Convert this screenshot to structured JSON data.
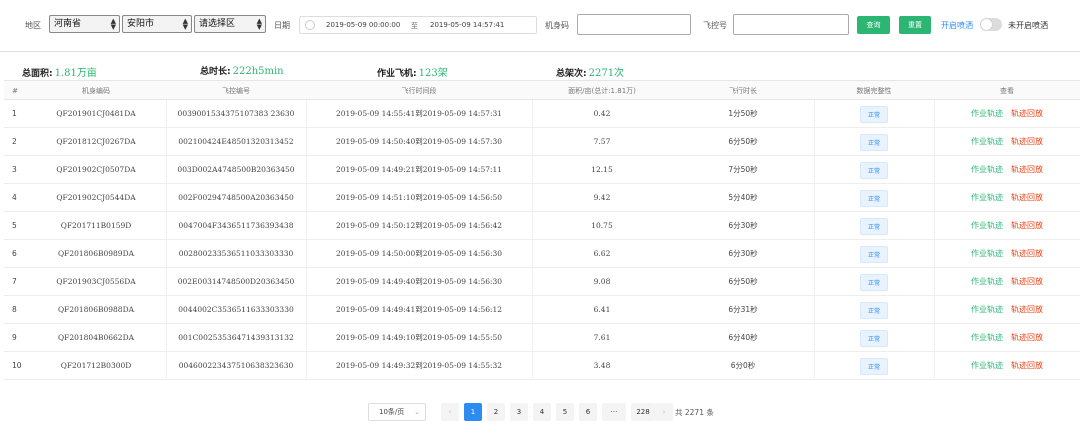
{
  "filters": {
    "region_label": "地区",
    "province": "河南省",
    "city": "安阳市",
    "district": "请选择区",
    "date_label": "日期",
    "date_start": "2019-05-09 00:00:00",
    "date_sep": "至",
    "date_end": "2019-05-09 14:57:41",
    "body_code_label": "机身码",
    "body_code_value": "",
    "fc_label": "飞控号",
    "fc_value": "",
    "query_button": "查询",
    "reset_button": "重置",
    "spray_on_link": "开启喷洒",
    "spray_off_label": "未开启喷洒"
  },
  "summary": {
    "area_label": "总面积:",
    "area_value": "1.81万亩",
    "duration_label": "总时长:",
    "duration_value": "222h5min",
    "aircraft_label": "作业飞机:",
    "aircraft_value": "123架",
    "sorties_label": "总架次:",
    "sorties_value": "2271次"
  },
  "table": {
    "headers": [
      "#",
      "机身编码",
      "飞控编号",
      "飞行时间段",
      "面积/亩(总计:1.81万)",
      "飞行时长",
      "数据完整性",
      "查看"
    ],
    "actions": {
      "work_track": "作业轨迹",
      "track_replay": "轨迹回放"
    },
    "rows": [
      {
        "idx": "1",
        "body": "QF201901CJ0481DA",
        "fc": "0039001534375107383 23630",
        "period": "2019-05-09 14:55:41到2019-05-09 14:57:31",
        "area": "0.42",
        "duration": "1分50秒",
        "status": "正常"
      },
      {
        "idx": "2",
        "body": "QF201812CJ0267DA",
        "fc": "002100424E48501320313452",
        "period": "2019-05-09 14:50:40到2019-05-09 14:57:30",
        "area": "7.57",
        "duration": "6分50秒",
        "status": "正常"
      },
      {
        "idx": "3",
        "body": "QF201902CJ0507DA",
        "fc": "003D002A4748500B20363450",
        "period": "2019-05-09 14:49:21到2019-05-09 14:57:11",
        "area": "12.15",
        "duration": "7分50秒",
        "status": "正常"
      },
      {
        "idx": "4",
        "body": "QF201902CJ0544DA",
        "fc": "002F00294748500A20363450",
        "period": "2019-05-09 14:51:10到2019-05-09 14:56:50",
        "area": "9.42",
        "duration": "5分40秒",
        "status": "正常"
      },
      {
        "idx": "5",
        "body": "QF201711B0159D",
        "fc": "0047004F3436511736393438",
        "period": "2019-05-09 14:50:12到2019-05-09 14:56:42",
        "area": "10.75",
        "duration": "6分30秒",
        "status": "正常"
      },
      {
        "idx": "6",
        "body": "QF201806B0989DA",
        "fc": "002800233536511033303330",
        "period": "2019-05-09 14:50:00到2019-05-09 14:56:30",
        "area": "6.62",
        "duration": "6分30秒",
        "status": "正常"
      },
      {
        "idx": "7",
        "body": "QF201903CJ0556DA",
        "fc": "002E00314748500D20363450",
        "period": "2019-05-09 14:49:40到2019-05-09 14:56:30",
        "area": "9.08",
        "duration": "6分50秒",
        "status": "正常"
      },
      {
        "idx": "8",
        "body": "QF201806B0988DA",
        "fc": "0044002C3536511633303330",
        "period": "2019-05-09 14:49:41到2019-05-09 14:56:12",
        "area": "6.41",
        "duration": "6分31秒",
        "status": "正常"
      },
      {
        "idx": "9",
        "body": "QF201804B0662DA",
        "fc": "001C00253536471439313132",
        "period": "2019-05-09 14:49:10到2019-05-09 14:55:50",
        "area": "7.61",
        "duration": "6分40秒",
        "status": "正常"
      },
      {
        "idx": "10",
        "body": "QF201712B0300D",
        "fc": "004600223437510638323630",
        "period": "2019-05-09 14:49:32到2019-05-09 14:55:32",
        "area": "3.48",
        "duration": "6分0秒",
        "status": "正常"
      }
    ]
  },
  "pagination": {
    "page_size": "10条/页",
    "prev": "‹",
    "pages": [
      "1",
      "2",
      "3",
      "4",
      "5",
      "6",
      "···",
      "228"
    ],
    "active_page": "1",
    "next": "›",
    "total_text": "共 2271 条"
  },
  "colors": {
    "green": "#2bb673",
    "blue": "#2d8cf0",
    "red": "#ed4014"
  }
}
